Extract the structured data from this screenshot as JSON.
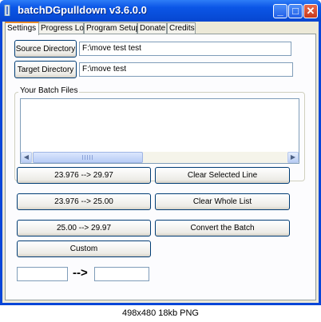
{
  "window": {
    "title": "batchDGpulldown v3.6.0.0"
  },
  "titlebar_buttons": {
    "minimize": "_",
    "maximize": "□",
    "close": "✕"
  },
  "tabs": [
    {
      "label": "Settings"
    },
    {
      "label": "Progress Log"
    },
    {
      "label": "Program Setup"
    },
    {
      "label": "Donate"
    },
    {
      "label": "Credits"
    }
  ],
  "settings": {
    "source_button": "Source Directory",
    "source_value": "F:\\move test test",
    "target_button": "Target Directory",
    "target_value": "F:\\move test",
    "batch_group_label": "Your Batch Files",
    "buttons": {
      "b1": "23.976 --> 29.97",
      "b2": "23.976 --> 25.00",
      "b3": "25.00 --> 29.97",
      "custom": "Custom",
      "clear_selected": "Clear Selected Line",
      "clear_whole": "Clear Whole List",
      "convert": "Convert the Batch"
    },
    "custom_from": "",
    "custom_to": "",
    "arrow": "-->"
  },
  "caption": "498x480  18kb  PNG"
}
